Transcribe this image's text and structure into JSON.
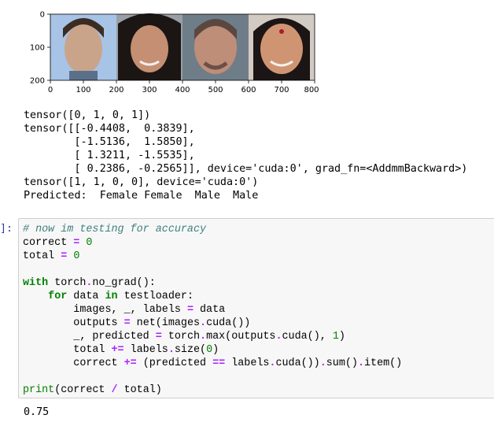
{
  "figure": {
    "y_ticks": [
      "0",
      "100",
      "200"
    ],
    "x_ticks": [
      "0",
      "100",
      "200",
      "300",
      "400",
      "500",
      "600",
      "700",
      "800"
    ],
    "faces": [
      {
        "name": "face-1",
        "skin": "#c9a48a",
        "bg": "#a7c3e6",
        "hair": "#3b2c22"
      },
      {
        "name": "face-2",
        "skin": "#c58f73",
        "bg": "#9a9fa6",
        "hair": "#1b1614"
      },
      {
        "name": "face-3",
        "skin": "#bf8e78",
        "bg": "#6f7d88",
        "hair": "#5a4840"
      },
      {
        "name": "face-4",
        "skin": "#cf9573",
        "bg": "#d2cbc3",
        "hair": "#1c1515"
      }
    ]
  },
  "output": {
    "line1": "tensor([0, 1, 0, 1])",
    "line2": "tensor([[-0.4408,  0.3839],",
    "line3": "        [-1.5136,  1.5850],",
    "line4": "        [ 1.3211, -1.5535],",
    "line5": "        [ 0.2386, -0.2565]], device='cuda:0', grad_fn=<AddmmBackward>)",
    "line6": "tensor([1, 1, 0, 0], device='cuda:0')",
    "line7": "Predicted:  Female Female  Male  Male"
  },
  "cell": {
    "prompt": "]:",
    "comment": "# now im testing for accuracy"
  },
  "result": "0.75"
}
